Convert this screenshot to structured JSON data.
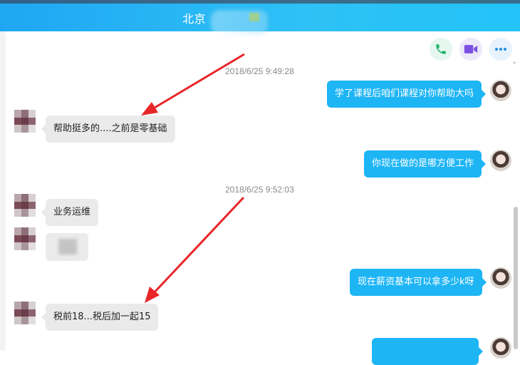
{
  "header": {
    "title": "北京"
  },
  "actions": {
    "phone_icon": "phone-icon",
    "video_icon": "video-icon",
    "more_icon": "more-icon"
  },
  "messages": [
    {
      "type": "timestamp",
      "text": "2018/6/25 9:49:28"
    },
    {
      "type": "out",
      "text": "学了课程后咱们课程对你帮助大吗"
    },
    {
      "type": "in",
      "text": "帮助挺多的....之前是零基础"
    },
    {
      "type": "out",
      "text": "你现在做的是哪方便工作"
    },
    {
      "type": "timestamp",
      "text": "2018/6/25 9:52:03"
    },
    {
      "type": "in",
      "text": "业务运维"
    },
    {
      "type": "in_image",
      "text": ""
    },
    {
      "type": "out",
      "text": "现在薪资基本可以拿多少k呀"
    },
    {
      "type": "in",
      "text": "税前18...税后加一起15"
    }
  ],
  "colors": {
    "accent": "#1eb5f5",
    "annotation_arrow": "#e8262a"
  }
}
